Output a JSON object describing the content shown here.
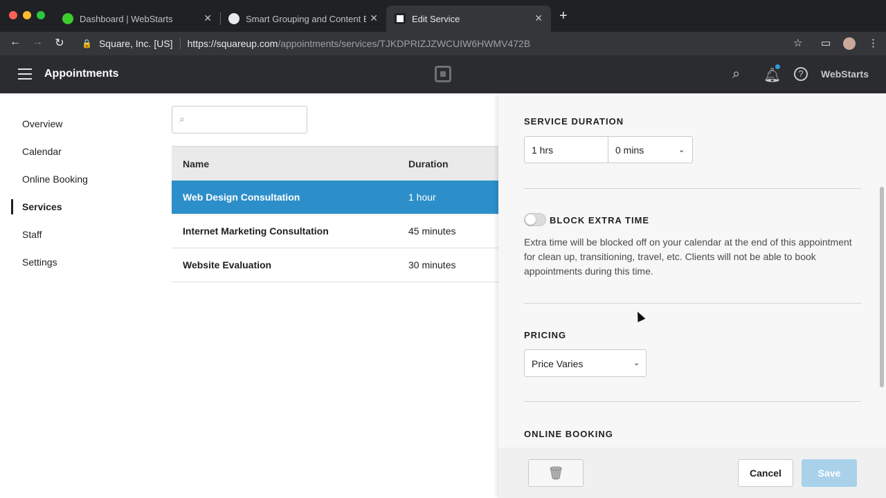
{
  "browser": {
    "tabs": [
      {
        "title": "Dashboard | WebStarts",
        "icon": "green-circle-icon",
        "active": false
      },
      {
        "title": "Smart Grouping and Content B",
        "icon": "globe-icon",
        "active": false
      },
      {
        "title": "Edit Service",
        "icon": "square-logo-icon",
        "active": true
      }
    ],
    "url_org": "Square, Inc. [US]",
    "url_host": "https://squareup.com",
    "url_path": "/appointments/services/TJKDPRIZJZWCUIW6HWMV472B"
  },
  "app": {
    "title": "Appointments",
    "account": "WebStarts"
  },
  "sidebar": {
    "items": [
      {
        "label": "Overview"
      },
      {
        "label": "Calendar"
      },
      {
        "label": "Online Booking"
      },
      {
        "label": "Services",
        "active": true
      },
      {
        "label": "Staff"
      },
      {
        "label": "Settings"
      }
    ]
  },
  "search": {
    "placeholder": ""
  },
  "table": {
    "headers": [
      "Name",
      "Duration"
    ],
    "rows": [
      {
        "name": "Web Design Consultation",
        "duration": "1 hour",
        "selected": true
      },
      {
        "name": "Internet Marketing Consultation",
        "duration": "45 minutes"
      },
      {
        "name": "Website Evaluation",
        "duration": "30 minutes"
      }
    ]
  },
  "drawer": {
    "service_duration_title": "SERVICE DURATION",
    "hours_value": "1 hrs",
    "minutes_value": "0 mins",
    "block_extra_time_title": "BLOCK EXTRA TIME",
    "block_extra_time_enabled": false,
    "block_extra_time_desc": "Extra time will be blocked off on your calendar at the end of this appointment for clean up, transitioning, travel, etc. Clients will not be able to book appointments during this time.",
    "pricing_title": "PRICING",
    "pricing_value": "Price Varies",
    "online_booking_title": "ONLINE BOOKING",
    "cancel_label": "Cancel",
    "save_label": "Save"
  },
  "colors": {
    "selected_row": "#2d8fc9",
    "save_disabled": "#a9d2ea",
    "header_bg": "#2b2c2f"
  }
}
